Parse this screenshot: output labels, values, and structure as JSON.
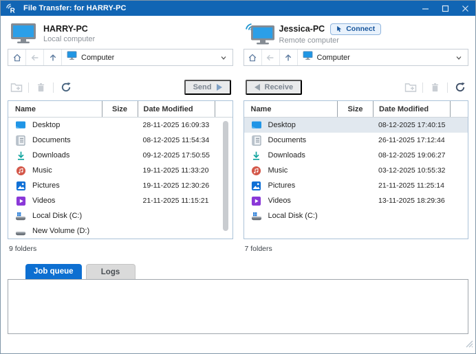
{
  "window": {
    "title": "File Transfer: for HARRY-PC"
  },
  "colors": {
    "titlebar": "#1165b4",
    "active_tab": "#0d6fd1",
    "selected_row": "#e1e8ef",
    "list_border": "#abc2d8",
    "connect_text": "#17559c"
  },
  "left_panel": {
    "computer": {
      "name": "HARRY-PC",
      "type": "Local computer"
    },
    "nav": {
      "path": "Computer"
    },
    "toolbar": {
      "send_label": "Send"
    },
    "table": {
      "headers": [
        "Name",
        "Size",
        "Date Modified"
      ]
    },
    "files": [
      {
        "name": "Desktop",
        "size": "",
        "date": "28-11-2025 16:09:33",
        "icon": "desktop-icon"
      },
      {
        "name": "Documents",
        "size": "",
        "date": "08-12-2025 11:54:34",
        "icon": "documents-icon"
      },
      {
        "name": "Downloads",
        "size": "",
        "date": "09-12-2025 17:50:55",
        "icon": "downloads-icon"
      },
      {
        "name": "Music",
        "size": "",
        "date": "19-11-2025 11:33:20",
        "icon": "music-icon"
      },
      {
        "name": "Pictures",
        "size": "",
        "date": "19-11-2025 12:30:26",
        "icon": "pictures-icon"
      },
      {
        "name": "Videos",
        "size": "",
        "date": "21-11-2025 11:15:21",
        "icon": "videos-icon"
      },
      {
        "name": "Local Disk (C:)",
        "size": "",
        "date": "",
        "icon": "local-disk-icon"
      },
      {
        "name": "New Volume (D:)",
        "size": "",
        "date": "",
        "icon": "new-volume-icon"
      }
    ],
    "status": "9 folders"
  },
  "right_panel": {
    "computer": {
      "name": "Jessica-PC",
      "type": "Remote computer",
      "connect_label": "Connect"
    },
    "nav": {
      "path": "Computer"
    },
    "toolbar": {
      "receive_label": "Receive"
    },
    "table": {
      "headers": [
        "Name",
        "Size",
        "Date Modified"
      ]
    },
    "files": [
      {
        "name": "Desktop",
        "size": "",
        "date": "08-12-2025 17:40:15",
        "icon": "desktop-icon",
        "selected": true
      },
      {
        "name": "Documents",
        "size": "",
        "date": "26-11-2025 17:12:44",
        "icon": "documents-icon"
      },
      {
        "name": "Downloads",
        "size": "",
        "date": "08-12-2025 19:06:27",
        "icon": "downloads-icon"
      },
      {
        "name": "Music",
        "size": "",
        "date": "03-12-2025 10:55:32",
        "icon": "music-icon"
      },
      {
        "name": "Pictures",
        "size": "",
        "date": "21-11-2025 11:25:14",
        "icon": "pictures-icon"
      },
      {
        "name": "Videos",
        "size": "",
        "date": "13-11-2025 18:29:36",
        "icon": "videos-icon"
      },
      {
        "name": "Local Disk (C:)",
        "size": "",
        "date": "",
        "icon": "local-disk-icon"
      }
    ],
    "status": "7 folders"
  },
  "bottom": {
    "tabs": [
      {
        "label": "Job queue",
        "active": true
      },
      {
        "label": "Logs",
        "active": false
      }
    ]
  }
}
